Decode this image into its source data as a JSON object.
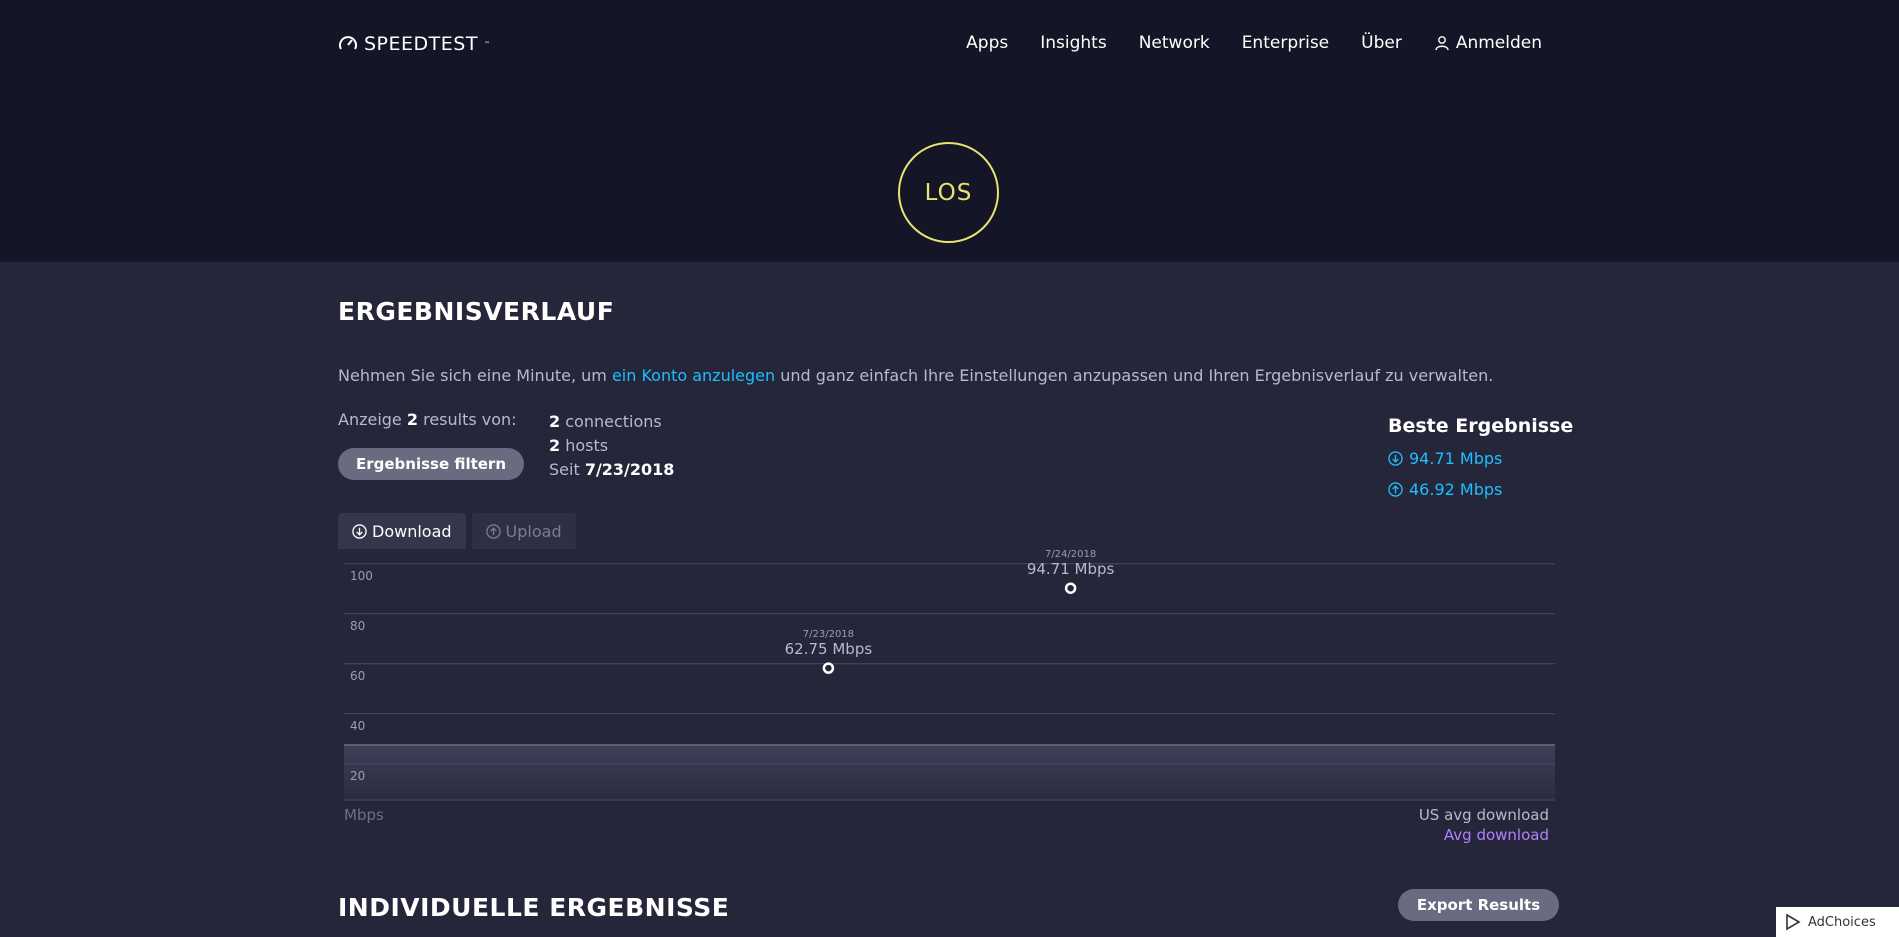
{
  "header": {
    "logo": "SPEEDTEST",
    "nav": [
      "Apps",
      "Insights",
      "Network",
      "Enterprise",
      "Über"
    ],
    "signin": "Anmelden"
  },
  "go_button": "LOS",
  "history": {
    "title": "ERGEBNISVERLAUF",
    "intro_before": "Nehmen Sie sich eine Minute, um ",
    "intro_link": "ein Konto anzulegen",
    "intro_after": " und ganz einfach Ihre Einstellungen anzupassen und Ihren Ergebnisverlauf zu verwalten.",
    "showing_prefix": "Anzeige ",
    "showing_count": "2",
    "showing_suffix": " results von:",
    "filter_button": "Ergebnisse filtern",
    "connections_count": "2",
    "connections_label": " connections",
    "hosts_count": "2",
    "hosts_label": " hosts",
    "since_label": "Seit ",
    "since_date": "7/23/2018"
  },
  "best": {
    "title": "Beste Ergebnisse",
    "download": "94.71 Mbps",
    "upload": "46.92 Mbps"
  },
  "tabs": {
    "download": "Download",
    "upload": "Upload"
  },
  "chart_data": {
    "type": "scatter",
    "ylim": [
      10,
      110
    ],
    "yticks": [
      100,
      80,
      60,
      40,
      20
    ],
    "avg_band": [
      10,
      32
    ],
    "points": [
      {
        "date": "7/23/2018",
        "value": 62.75,
        "label": "62.75 Mbps",
        "x_pos": 0.4
      },
      {
        "date": "7/24/2018",
        "value": 94.71,
        "label": "94.71 Mbps",
        "x_pos": 0.6
      }
    ],
    "unit": "Mbps",
    "legend": [
      "US avg download",
      "Avg download"
    ],
    "colors": {
      "grid": "#4a4b62",
      "point": "#ffffff",
      "avg": "#b47fff",
      "band": "#3d3e55"
    }
  },
  "individual": {
    "title": "INDIVIDUELLE ERGEBNISSE",
    "export_button": "Export Results"
  },
  "ad": {
    "label": "AdChoices"
  }
}
